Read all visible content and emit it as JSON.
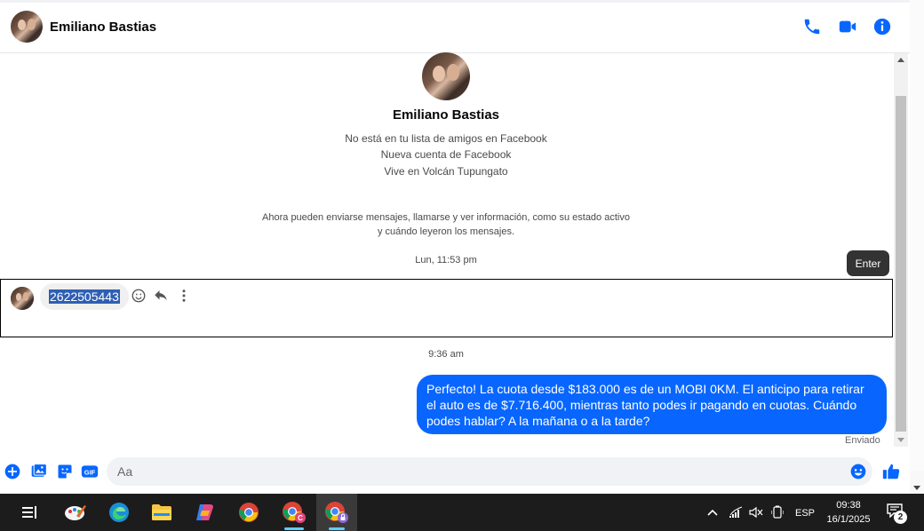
{
  "header": {
    "contact_name": "Emiliano Bastias",
    "icons": [
      "phone-icon",
      "video-icon",
      "info-icon"
    ]
  },
  "profile": {
    "name": "Emiliano Bastias",
    "lines": [
      "No está en tu lista de amigos en Facebook",
      "Nueva cuenta de Facebook",
      "Vive en Volcán Tupungato"
    ]
  },
  "notice": {
    "line1": "Ahora pueden enviarse mensajes, llamarse y ver información, como su estado activo",
    "line2": "y cuándo leyeron los mensajes."
  },
  "timestamps": {
    "first": "Lun, 11:53 pm",
    "second": "9:36 am"
  },
  "tooltip": "Enter",
  "incoming_message": {
    "text": "2622505443",
    "icons": [
      "smile-icon",
      "reply-icon",
      "more-icon"
    ]
  },
  "outgoing_message": {
    "text": "Perfecto! La cuota desde $183.000 es de un MOBI 0KM. El anticipo para retirar el auto es de $7.716.400, mientras tanto podes ir pagando en cuotas. Cuándo podes hablar? A la mañana o a la tarde?",
    "status": "Enviado"
  },
  "composer": {
    "placeholder": "Aa",
    "icons": [
      "plus-icon",
      "image-icon",
      "sticker-icon",
      "gif-icon",
      "emoji-icon",
      "like-icon"
    ],
    "gif_label": "GIF"
  },
  "colors": {
    "accent": "#0866ff",
    "taskbar": "#1c1c1c"
  },
  "taskbar": {
    "apps": [
      "task-view",
      "paint",
      "edge",
      "file-explorer",
      "copilot",
      "chrome",
      "chrome-profile-c",
      "chrome-profile-lock"
    ],
    "tray_language": "ESP",
    "time": "09:38",
    "date": "16/1/2025",
    "notification_count": "2"
  }
}
